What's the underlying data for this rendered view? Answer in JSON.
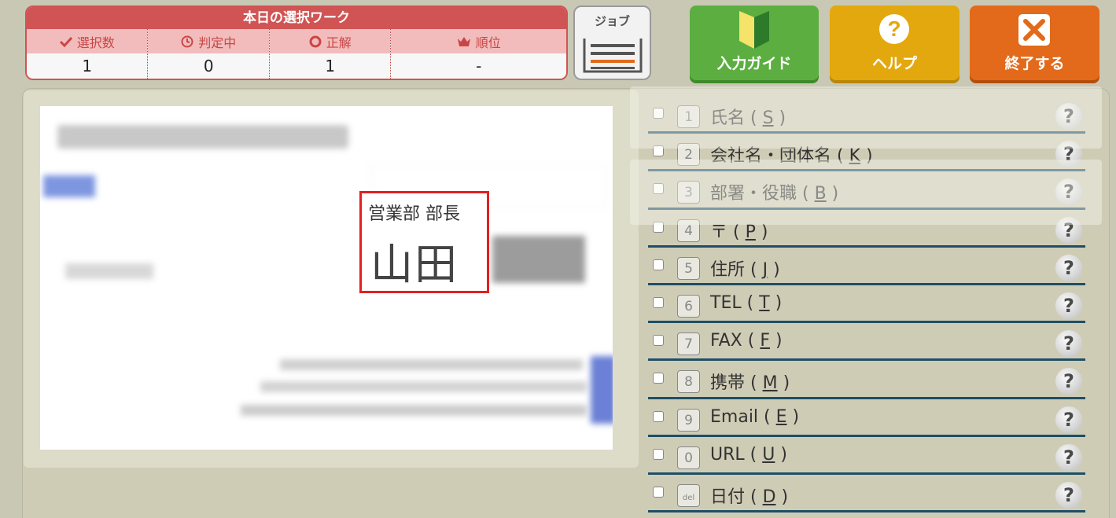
{
  "stats": {
    "title": "本日の選択ワーク",
    "columns": [
      {
        "label": "選択数",
        "icon": "check-icon",
        "value": "1"
      },
      {
        "label": "判定中",
        "icon": "clock-icon",
        "value": "0"
      },
      {
        "label": "正解",
        "icon": "circle-icon",
        "value": "1"
      },
      {
        "label": "順位",
        "icon": "crown-icon",
        "value": "-"
      }
    ]
  },
  "job_button": {
    "label": "ジョブ"
  },
  "actions": {
    "guide_label": "入力ガイド",
    "help_label": "ヘルプ",
    "exit_label": "終了する"
  },
  "card": {
    "highlight_title": "営業部 部長",
    "highlight_name": "山田"
  },
  "fields": [
    {
      "num": "1",
      "label": "氏名",
      "key": "S"
    },
    {
      "num": "2",
      "label": "会社名・団体名",
      "key": "K"
    },
    {
      "num": "3",
      "label": "部署・役職",
      "key": "B"
    },
    {
      "num": "4",
      "label": "〒",
      "key": "P"
    },
    {
      "num": "5",
      "label": "住所",
      "key": "J"
    },
    {
      "num": "6",
      "label": "TEL",
      "key": "T"
    },
    {
      "num": "7",
      "label": "FAX",
      "key": "F"
    },
    {
      "num": "8",
      "label": "携帯",
      "key": "M"
    },
    {
      "num": "9",
      "label": "Email",
      "key": "E"
    },
    {
      "num": "0",
      "label": "URL",
      "key": "U"
    },
    {
      "num": "del",
      "label": "日付",
      "key": "D"
    }
  ],
  "colors": {
    "stats_red": "#d05454",
    "guide_green": "#5cae41",
    "help_yellow": "#e3a80d",
    "exit_orange": "#e26a1a",
    "highlight_red": "#e32020",
    "row_line": "#1e4f66"
  }
}
